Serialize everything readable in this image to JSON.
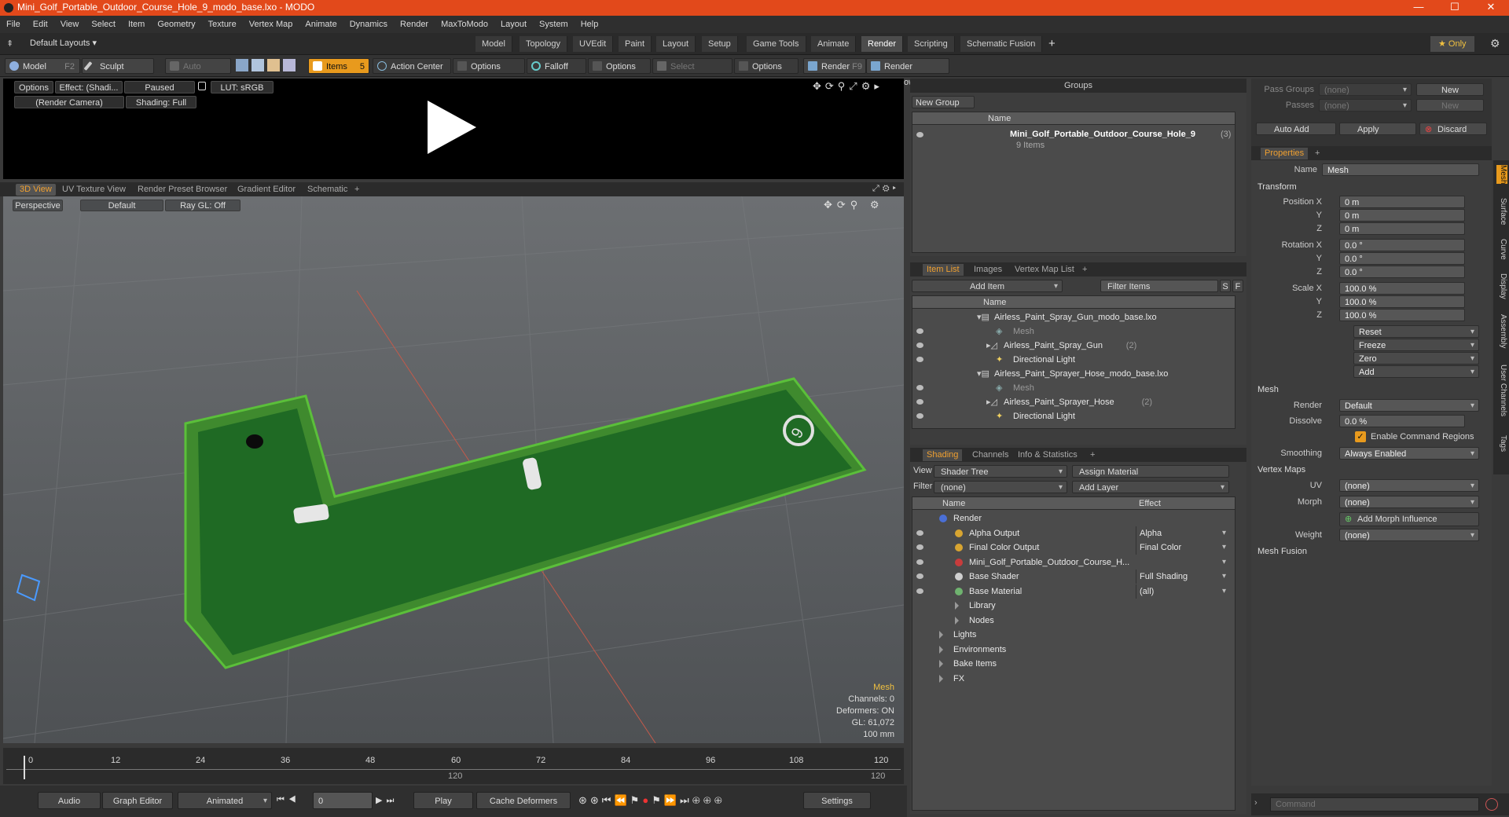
{
  "window": {
    "title": "Mini_Golf_Portable_Outdoor_Course_Hole_9_modo_base.lxo - MODO",
    "minimize": "—",
    "maximize": "☐",
    "close": "✕"
  },
  "menu": [
    "File",
    "Edit",
    "View",
    "Select",
    "Item",
    "Geometry",
    "Texture",
    "Vertex Map",
    "Animate",
    "Dynamics",
    "Render",
    "MaxToModo",
    "Layout",
    "System",
    "Help"
  ],
  "layout": {
    "label": "Default Layouts ▾",
    "tabs": [
      "Model",
      "Topology",
      "UVEdit",
      "Paint",
      "Layout",
      "Setup",
      "Game Tools",
      "Animate",
      "Render",
      "Scripting",
      "Schematic Fusion"
    ],
    "active": "Render",
    "add": "+",
    "only": "★ Only",
    "gear": "⚙"
  },
  "toolbar": {
    "model": "Model",
    "model_key": "F2",
    "sculpt": "Sculpt",
    "auto_select": "Auto Select",
    "items": "Items",
    "items_count": "5",
    "action_center": "Action Center",
    "options1": "Options",
    "falloff": "Falloff",
    "options2": "Options",
    "select_through": "Select Through",
    "options3": "Options",
    "render": "Render",
    "render_key": "F9",
    "render_window": "Render Window"
  },
  "render_preview": {
    "options": "Options",
    "effect": "Effect: (Shadi...",
    "paused": "Paused",
    "lut": "LUT: sRGB",
    "camera": "(Render Camera)",
    "shading": "Shading: Full"
  },
  "viewport_tabs": [
    "3D View",
    "UV Texture View",
    "Render Preset Browser",
    "Gradient Editor",
    "Schematic",
    "+"
  ],
  "viewport": {
    "perspective": "Perspective",
    "default": "Default",
    "raygl": "Ray GL: Off",
    "hud_mesh": "Mesh",
    "hud_channels": "Channels: 0",
    "hud_deformers": "Deformers: ON",
    "hud_gl": "GL: 61,072",
    "hud_size": "100 mm",
    "hole_number": "9"
  },
  "timeline": {
    "ticks": [
      "0",
      "12",
      "24",
      "36",
      "48",
      "60",
      "72",
      "84",
      "96",
      "108",
      "120"
    ],
    "mid_mark": "120",
    "end_mark": "120"
  },
  "bottom": {
    "audio": "Audio",
    "graph_editor": "Graph Editor",
    "animated": "Animated",
    "frame": "0",
    "play": "Play",
    "cache": "Cache Deformers",
    "settings": "Settings"
  },
  "groups": {
    "header": "Groups",
    "new_group": "New Group",
    "col_name": "Name",
    "item_name": "Mini_Golf_Portable_Outdoor_Course_Hole_9",
    "item_count": "(3)",
    "item_sub": "9 Items"
  },
  "itemlist": {
    "tabs": [
      "Item List",
      "Images",
      "Vertex Map List",
      "+"
    ],
    "add_item": "Add Item",
    "filter": "Filter Items",
    "s": "S",
    "f": "F",
    "col_name": "Name",
    "rows": [
      {
        "text": "Airless_Paint_Spray_Gun_modo_base.lxo",
        "indent": 0,
        "kind": "scene"
      },
      {
        "text": "Mesh",
        "indent": 2,
        "kind": "mesh"
      },
      {
        "text": "Airless_Paint_Spray_Gun",
        "suffix": "(2)",
        "indent": 1,
        "kind": "group"
      },
      {
        "text": "Directional Light",
        "indent": 2,
        "kind": "light"
      },
      {
        "text": "Airless_Paint_Sprayer_Hose_modo_base.lxo",
        "indent": 0,
        "kind": "scene"
      },
      {
        "text": "Mesh",
        "indent": 2,
        "kind": "mesh"
      },
      {
        "text": "Airless_Paint_Sprayer_Hose",
        "suffix": "(2)",
        "indent": 1,
        "kind": "group"
      },
      {
        "text": "Directional Light",
        "indent": 2,
        "kind": "light"
      }
    ]
  },
  "shading": {
    "tabs": [
      "Shading",
      "Channels",
      "Info & Statistics",
      "+"
    ],
    "view_label": "View",
    "view_value": "Shader Tree",
    "assign": "Assign Material",
    "filter_label": "Filter",
    "filter_value": "(none)",
    "add_layer": "Add Layer",
    "col_name": "Name",
    "col_effect": "Effect",
    "rows": [
      {
        "name": "Render",
        "effect": "",
        "indent": 0,
        "eye": false,
        "color": "#4a6fd6"
      },
      {
        "name": "Alpha Output",
        "effect": "Alpha",
        "indent": 1,
        "eye": true,
        "color": "#d8a531"
      },
      {
        "name": "Final Color Output",
        "effect": "Final Color",
        "indent": 1,
        "eye": true,
        "color": "#d8a531"
      },
      {
        "name": "Mini_Golf_Portable_Outdoor_Course_H...",
        "effect": "",
        "indent": 1,
        "eye": true,
        "color": "#c83c3c"
      },
      {
        "name": "Base Shader",
        "effect": "Full Shading",
        "indent": 1,
        "eye": true,
        "color": "#cfcfcf"
      },
      {
        "name": "Base Material",
        "effect": "(all)",
        "indent": 1,
        "eye": true,
        "color": "#6fb36f"
      },
      {
        "name": "Library",
        "effect": "",
        "indent": 1,
        "eye": false,
        "color": ""
      },
      {
        "name": "Nodes",
        "effect": "",
        "indent": 1,
        "eye": false,
        "color": ""
      },
      {
        "name": "Lights",
        "effect": "",
        "indent": 0,
        "eye": false,
        "color": ""
      },
      {
        "name": "Environments",
        "effect": "",
        "indent": 0,
        "eye": false,
        "color": ""
      },
      {
        "name": "Bake Items",
        "effect": "",
        "indent": 0,
        "eye": false,
        "color": ""
      },
      {
        "name": "FX",
        "effect": "",
        "indent": 0,
        "eye": false,
        "color": ""
      }
    ]
  },
  "pass": {
    "pass_groups": "Pass Groups",
    "passes": "Passes",
    "none": "(none)",
    "new": "New",
    "auto_add": "Auto Add",
    "apply": "Apply",
    "discard": "Discard"
  },
  "properties": {
    "tab": "Properties",
    "add": "+",
    "name_label": "Name",
    "name_value": "Mesh",
    "transform": "Transform",
    "position_x": "Position X",
    "position_y": "Y",
    "position_z": "Z",
    "pos_vals": [
      "0 m",
      "0 m",
      "0 m"
    ],
    "rotation_x": "Rotation X",
    "rot_vals": [
      "0.0 °",
      "0.0 °",
      "0.0 °"
    ],
    "scale_x": "Scale X",
    "scale_vals": [
      "100.0 %",
      "100.0 %",
      "100.0 %"
    ],
    "reset": "Reset",
    "freeze": "Freeze",
    "zero": "Zero",
    "add_btn": "Add",
    "mesh": "Mesh",
    "render_label": "Render",
    "render_value": "Default",
    "dissolve_label": "Dissolve",
    "dissolve_value": "0.0 %",
    "enable_cmd": "Enable Command Regions",
    "smoothing_label": "Smoothing",
    "smoothing_value": "Always Enabled",
    "vertex_maps": "Vertex Maps",
    "uv_label": "UV",
    "uv_value": "(none)",
    "morph_label": "Morph",
    "morph_value": "(none)",
    "add_morph": "Add Morph Influence",
    "weight_label": "Weight",
    "weight_value": "(none)",
    "mesh_fusion": "Mesh Fusion"
  },
  "side_tabs": [
    "Mesh",
    "Surface",
    "Curve",
    "Display",
    "Assembly",
    "User Channels",
    "Tags"
  ],
  "command": {
    "placeholder": "Command"
  }
}
